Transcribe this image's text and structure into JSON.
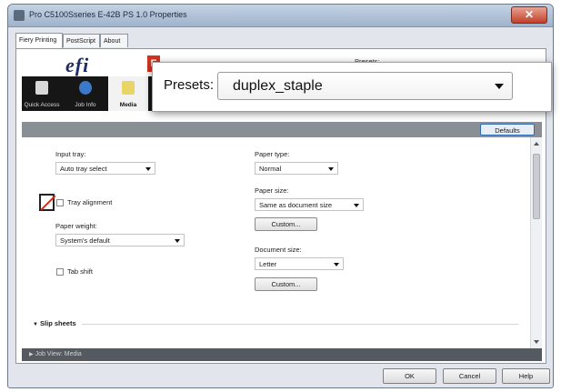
{
  "window": {
    "title": "Pro C5100Sseries E-42B PS 1.0 Properties",
    "close_label": "✕"
  },
  "tabs": [
    {
      "label": "Fiery Printing"
    },
    {
      "label": "PostScript"
    },
    {
      "label": "About"
    }
  ],
  "header": {
    "logo_text": "efi",
    "badge_text": "F",
    "bg_presets_label": "Presets:",
    "bg_presets_value": "duplex_staple"
  },
  "ribbon": {
    "items": [
      {
        "label": "Quick Access",
        "icon": "document-icon"
      },
      {
        "label": "Job Info",
        "icon": "info-icon"
      },
      {
        "label": "Media",
        "icon": "media-icon"
      }
    ]
  },
  "toolbar": {
    "defaults_label": "Defaults"
  },
  "media": {
    "input_tray_label": "Input tray:",
    "input_tray_value": "Auto tray select",
    "tray_alignment_label": "Tray alignment",
    "paper_weight_label": "Paper weight:",
    "paper_weight_value": "System's default",
    "tab_shift_label": "Tab shift",
    "paper_type_label": "Paper type:",
    "paper_type_value": "Normal",
    "paper_size_label": "Paper size:",
    "paper_size_value": "Same as document size",
    "custom_label_1": "Custom...",
    "document_size_label": "Document size:",
    "document_size_value": "Letter",
    "custom_label_2": "Custom..."
  },
  "slip": {
    "label": "Slip sheets"
  },
  "job_view": {
    "label": "Job View: Media"
  },
  "footer": {
    "ok_label": "OK",
    "cancel_label": "Cancel",
    "help_label": "Help"
  },
  "presets_popup": {
    "label": "Presets:",
    "value": "duplex_staple"
  },
  "colors": {
    "ribbon_bg": "#161616",
    "badge_red": "#d4331f",
    "accent_blue": "#2f6bb8"
  }
}
